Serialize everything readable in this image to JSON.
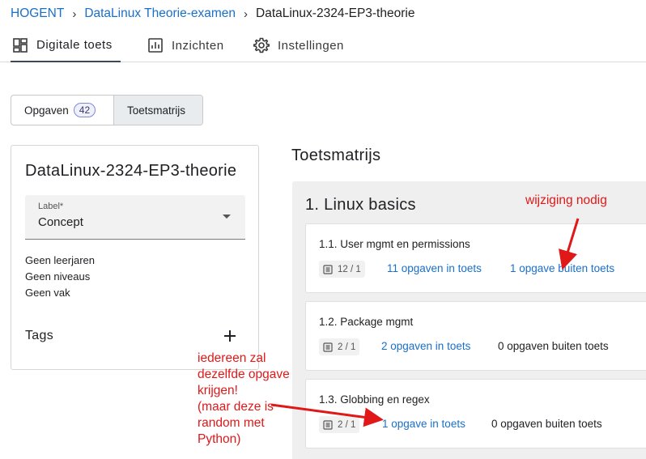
{
  "breadcrumb": {
    "items": [
      "HOGENT",
      "DataLinux Theorie-examen",
      "DataLinux-2324-EP3-theorie"
    ],
    "separator": "›"
  },
  "nav": {
    "tabs": [
      {
        "label": "Digitale toets",
        "icon": "dashboard-icon",
        "active": true
      },
      {
        "label": "Inzichten",
        "icon": "chart-icon",
        "active": false
      },
      {
        "label": "Instellingen",
        "icon": "gear-icon",
        "active": false
      }
    ]
  },
  "toggle": {
    "opgaven_label": "Opgaven",
    "opgaven_count": "42",
    "toetsmatrijs_label": "Toetsmatrijs"
  },
  "card": {
    "title": "DataLinux-2324-EP3-theorie",
    "select_label": "Label*",
    "select_value": "Concept",
    "meta": [
      "Geen leerjaren",
      "Geen niveaus",
      "Geen vak"
    ],
    "tags_label": "Tags"
  },
  "matrix": {
    "title": "Toetsmatrijs",
    "section_title": "1. Linux basics",
    "items": [
      {
        "name": "1.1. User mgmt en permissions",
        "chip": "12 / 1",
        "in_toets": "11 opgaven in toets",
        "buiten_toets": "1 opgave buiten toets",
        "buiten_is_link": true
      },
      {
        "name": "1.2. Package mgmt",
        "chip": "2 / 1",
        "in_toets": "2 opgaven in toets",
        "buiten_toets": "0 opgaven buiten toets",
        "buiten_is_link": false
      },
      {
        "name": "1.3. Globbing en regex",
        "chip": "2 / 1",
        "in_toets": "1 opgave in toets",
        "buiten_toets": "0 opgaven buiten toets",
        "buiten_is_link": false
      }
    ]
  },
  "annotations": {
    "note1": "wijziging nodig",
    "note2": "iedereen zal\ndezelfde opgave\nkrijgen!\n(maar deze is\nrandom met\nPython)"
  },
  "colors": {
    "link": "#1a6fc9",
    "annotation": "#e01818",
    "badge_border": "#7f8bd0"
  }
}
